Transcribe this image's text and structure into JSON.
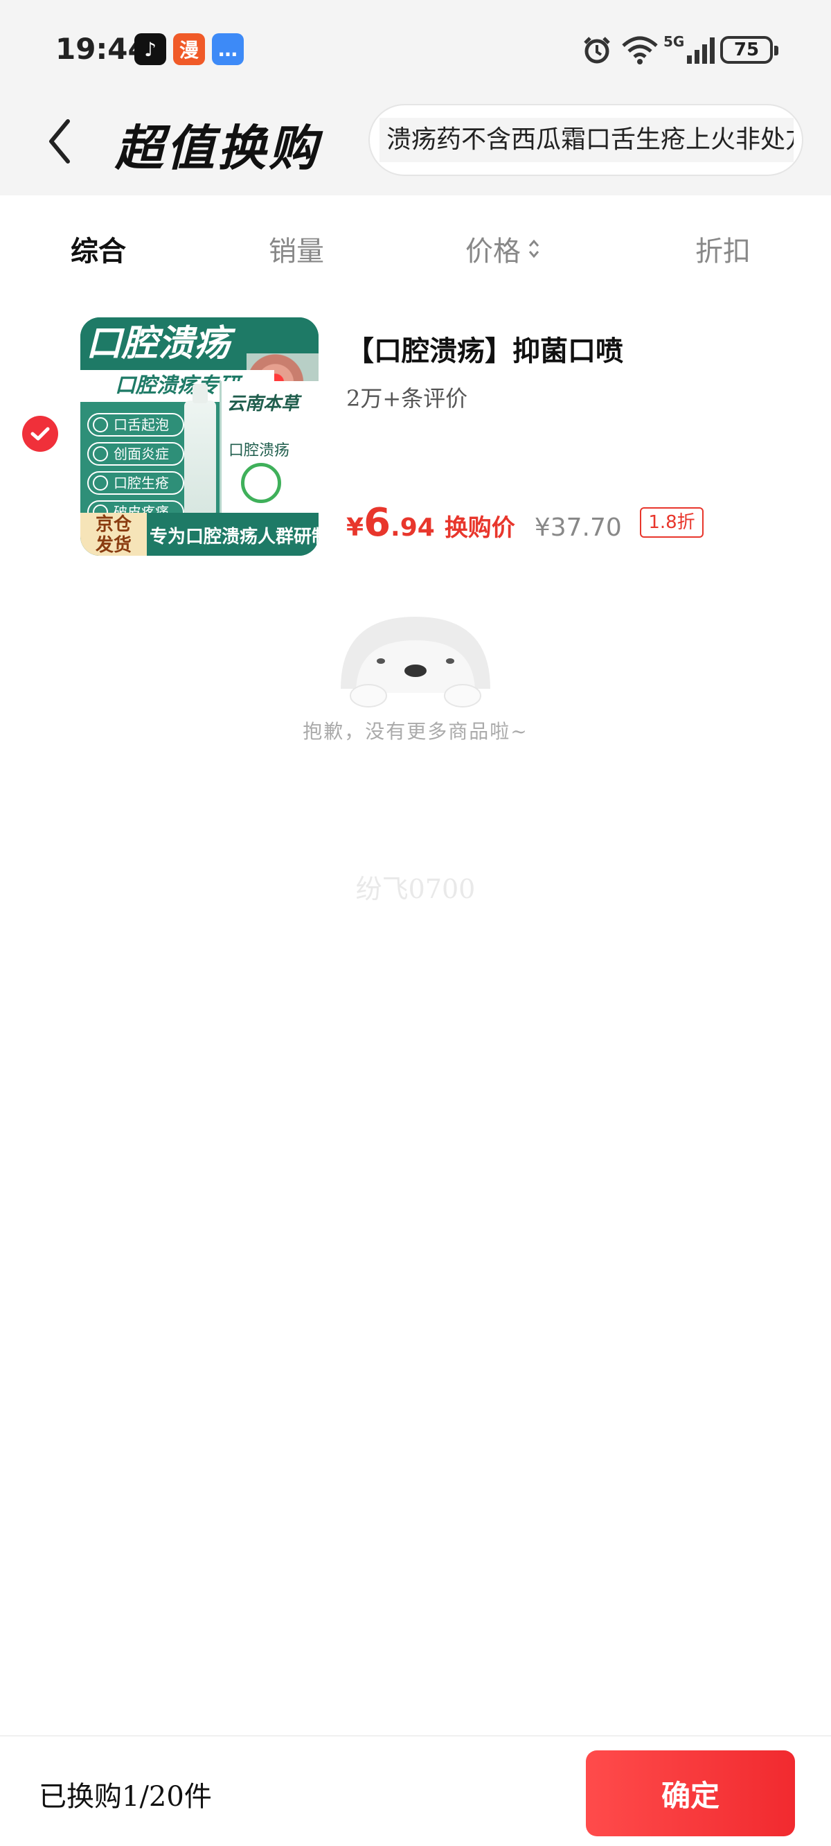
{
  "status_bar": {
    "time": "19:44",
    "apps": [
      {
        "name": "tiktok-icon",
        "glyph": "♪"
      },
      {
        "name": "manga-app-icon",
        "glyph": "漫"
      },
      {
        "name": "message-app-icon",
        "glyph": "…"
      }
    ],
    "network": "5G",
    "battery": "75"
  },
  "header": {
    "title": "超值换购",
    "search_text": "溃疡药不含西瓜霜口舌生疮上火非处方"
  },
  "tabs": [
    {
      "label": "综合",
      "active": true
    },
    {
      "label": "销量",
      "active": false
    },
    {
      "label": "价格",
      "active": false,
      "sortable": true
    },
    {
      "label": "折扣",
      "active": false
    }
  ],
  "product": {
    "selected": true,
    "image": {
      "title": "口腔溃疡",
      "subtitle": "口腔溃疡专研",
      "features": [
        "口舌起泡",
        "创面炎症",
        "口腔生疮",
        "破皮疼痛"
      ],
      "box_brand": "云南本草",
      "box_name": "口腔溃疡",
      "badge": [
        "京仓",
        "发货"
      ],
      "footer": "专为口腔溃疡人群研制"
    },
    "title": "【口腔溃疡】抑菌口喷",
    "reviews": "2万+条评价",
    "currency": "¥",
    "price_int": "6",
    "price_dec": ".94",
    "price_label": "换购价",
    "original_price": "¥37.70",
    "discount": "1.8折"
  },
  "empty_state": {
    "message": "抱歉，没有更多商品啦~"
  },
  "watermark": "纷飞0700",
  "bottom_bar": {
    "summary": "已换购1/20件",
    "confirm_label": "确定"
  },
  "colors": {
    "accent": "#e8362c",
    "confirm_button": "#f12a2f",
    "header_bg": "#f4f4f4"
  }
}
